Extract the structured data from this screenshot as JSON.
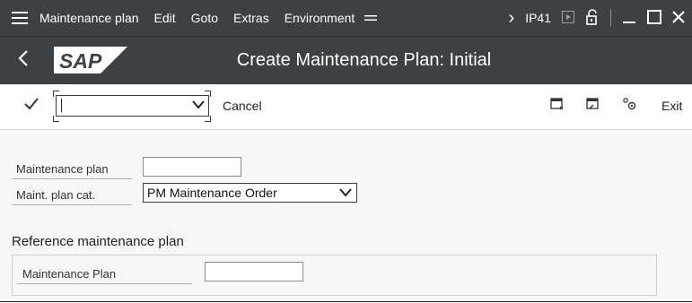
{
  "menubar": {
    "items": [
      {
        "label": "Maintenance plan"
      },
      {
        "label": "Edit"
      },
      {
        "label": "Goto"
      },
      {
        "label": "Extras"
      },
      {
        "label": "Environment"
      }
    ],
    "tcode": "IP41"
  },
  "titlebar": {
    "logo": "SAP",
    "title": "Create Maintenance Plan: Initial"
  },
  "toolbar": {
    "okcode_value": "",
    "cancel_label": "Cancel",
    "exit_label": "Exit"
  },
  "form": {
    "plan_label": "Maintenance plan",
    "plan_value": "",
    "cat_label": "Maint. plan cat.",
    "cat_value": "PM Maintenance Order"
  },
  "reference": {
    "heading": "Reference maintenance plan",
    "plan_label": "Maintenance Plan",
    "plan_value": ""
  },
  "colors": {
    "shell": "#3d4144",
    "background": "#f7f7f7"
  }
}
